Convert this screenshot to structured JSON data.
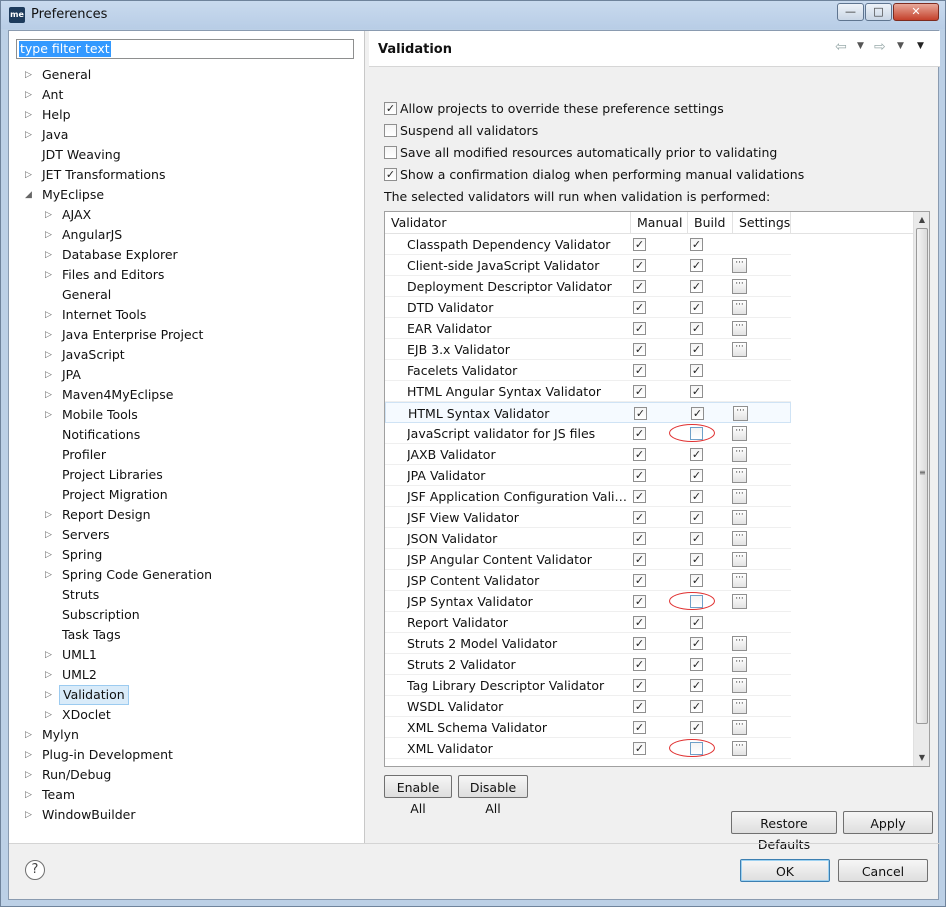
{
  "window": {
    "app_logo": "me",
    "title": "Preferences",
    "controls": {
      "minimize": "—",
      "maximize": "□",
      "close": "✕"
    }
  },
  "filter": {
    "text": "type filter text"
  },
  "tree": [
    {
      "label": "General",
      "expander": "▷",
      "level": 0
    },
    {
      "label": "Ant",
      "expander": "▷",
      "level": 0
    },
    {
      "label": "Help",
      "expander": "▷",
      "level": 0
    },
    {
      "label": "Java",
      "expander": "▷",
      "level": 0
    },
    {
      "label": "JDT Weaving",
      "expander": "",
      "level": 0
    },
    {
      "label": "JET Transformations",
      "expander": "▷",
      "level": 0
    },
    {
      "label": "MyEclipse",
      "expander": "◢",
      "level": 0
    },
    {
      "label": "AJAX",
      "expander": "▷",
      "level": 1
    },
    {
      "label": "AngularJS",
      "expander": "▷",
      "level": 1
    },
    {
      "label": "Database Explorer",
      "expander": "▷",
      "level": 1
    },
    {
      "label": "Files and Editors",
      "expander": "▷",
      "level": 1
    },
    {
      "label": "General",
      "expander": "",
      "level": 1
    },
    {
      "label": "Internet Tools",
      "expander": "▷",
      "level": 1
    },
    {
      "label": "Java Enterprise Project",
      "expander": "▷",
      "level": 1
    },
    {
      "label": "JavaScript",
      "expander": "▷",
      "level": 1
    },
    {
      "label": "JPA",
      "expander": "▷",
      "level": 1
    },
    {
      "label": "Maven4MyEclipse",
      "expander": "▷",
      "level": 1
    },
    {
      "label": "Mobile Tools",
      "expander": "▷",
      "level": 1
    },
    {
      "label": "Notifications",
      "expander": "",
      "level": 1
    },
    {
      "label": "Profiler",
      "expander": "",
      "level": 1
    },
    {
      "label": "Project Libraries",
      "expander": "",
      "level": 1
    },
    {
      "label": "Project Migration",
      "expander": "",
      "level": 1
    },
    {
      "label": "Report Design",
      "expander": "▷",
      "level": 1
    },
    {
      "label": "Servers",
      "expander": "▷",
      "level": 1
    },
    {
      "label": "Spring",
      "expander": "▷",
      "level": 1
    },
    {
      "label": "Spring Code Generation",
      "expander": "▷",
      "level": 1
    },
    {
      "label": "Struts",
      "expander": "",
      "level": 1
    },
    {
      "label": "Subscription",
      "expander": "",
      "level": 1
    },
    {
      "label": "Task Tags",
      "expander": "",
      "level": 1
    },
    {
      "label": "UML1",
      "expander": "▷",
      "level": 1
    },
    {
      "label": "UML2",
      "expander": "▷",
      "level": 1
    },
    {
      "label": "Validation",
      "expander": "▷",
      "level": 1,
      "selected": true
    },
    {
      "label": "XDoclet",
      "expander": "▷",
      "level": 1
    },
    {
      "label": "Mylyn",
      "expander": "▷",
      "level": 0
    },
    {
      "label": "Plug-in Development",
      "expander": "▷",
      "level": 0
    },
    {
      "label": "Run/Debug",
      "expander": "▷",
      "level": 0
    },
    {
      "label": "Team",
      "expander": "▷",
      "level": 0
    },
    {
      "label": "WindowBuilder",
      "expander": "▷",
      "level": 0
    }
  ],
  "page": {
    "title": "Validation",
    "nav": {
      "back": "⇦",
      "forward": "⇨",
      "caret": "▼",
      "menu": "▼"
    },
    "options": [
      {
        "label": "Allow projects to override these preference settings",
        "checked": true
      },
      {
        "label": "Suspend all validators",
        "checked": false
      },
      {
        "label": "Save all modified resources automatically prior to validating",
        "checked": false
      },
      {
        "label": "Show a confirmation dialog when performing manual validations",
        "checked": true
      }
    ],
    "info": "The selected validators will run when validation is performed:",
    "check_glyph": "✓",
    "settings_glyph": "···",
    "table": {
      "headers": [
        "Validator",
        "Manual",
        "Build",
        "Settings"
      ],
      "rows": [
        {
          "name": "Classpath Dependency Validator",
          "manual": true,
          "build": true,
          "settings": false
        },
        {
          "name": "Client-side JavaScript Validator",
          "manual": true,
          "build": true,
          "settings": true
        },
        {
          "name": "Deployment Descriptor Validator",
          "manual": true,
          "build": true,
          "settings": true
        },
        {
          "name": "DTD Validator",
          "manual": true,
          "build": true,
          "settings": true
        },
        {
          "name": "EAR Validator",
          "manual": true,
          "build": true,
          "settings": true
        },
        {
          "name": "EJB 3.x Validator",
          "manual": true,
          "build": true,
          "settings": true
        },
        {
          "name": "Facelets Validator",
          "manual": true,
          "build": true,
          "settings": false
        },
        {
          "name": "HTML Angular Syntax Validator",
          "manual": true,
          "build": true,
          "settings": false
        },
        {
          "name": "HTML Syntax Validator",
          "manual": true,
          "build": true,
          "settings": true,
          "highlight": true
        },
        {
          "name": "JavaScript validator for JS files",
          "manual": true,
          "build": false,
          "settings": true,
          "circled": true
        },
        {
          "name": "JAXB Validator",
          "manual": true,
          "build": true,
          "settings": true
        },
        {
          "name": "JPA Validator",
          "manual": true,
          "build": true,
          "settings": true
        },
        {
          "name": "JSF Application Configuration Validator",
          "manual": true,
          "build": true,
          "settings": true
        },
        {
          "name": "JSF View Validator",
          "manual": true,
          "build": true,
          "settings": true
        },
        {
          "name": "JSON Validator",
          "manual": true,
          "build": true,
          "settings": true
        },
        {
          "name": "JSP Angular Content Validator",
          "manual": true,
          "build": true,
          "settings": true
        },
        {
          "name": "JSP Content Validator",
          "manual": true,
          "build": true,
          "settings": true
        },
        {
          "name": "JSP Syntax Validator",
          "manual": true,
          "build": false,
          "settings": true,
          "circled": true
        },
        {
          "name": "Report Validator",
          "manual": true,
          "build": true,
          "settings": false
        },
        {
          "name": "Struts 2 Model Validator",
          "manual": true,
          "build": true,
          "settings": true
        },
        {
          "name": "Struts 2 Validator",
          "manual": true,
          "build": true,
          "settings": true
        },
        {
          "name": "Tag Library Descriptor Validator",
          "manual": true,
          "build": true,
          "settings": true
        },
        {
          "name": "WSDL Validator",
          "manual": true,
          "build": true,
          "settings": true
        },
        {
          "name": "XML Schema Validator",
          "manual": true,
          "build": true,
          "settings": true
        },
        {
          "name": "XML Validator",
          "manual": true,
          "build": false,
          "settings": true,
          "circled": true
        }
      ]
    },
    "scrollbar": {
      "up": "▲",
      "down": "▼",
      "grip": "≡"
    },
    "buttons": {
      "enable_all": "Enable All",
      "disable_all": "Disable All",
      "restore_defaults": "Restore Defaults",
      "apply": "Apply"
    }
  },
  "footer": {
    "help": "?",
    "ok": "OK",
    "cancel": "Cancel"
  },
  "colors": {
    "selection": "#3399ff",
    "annotation": "#e03030",
    "tree_selected": "#d9ebf9"
  }
}
